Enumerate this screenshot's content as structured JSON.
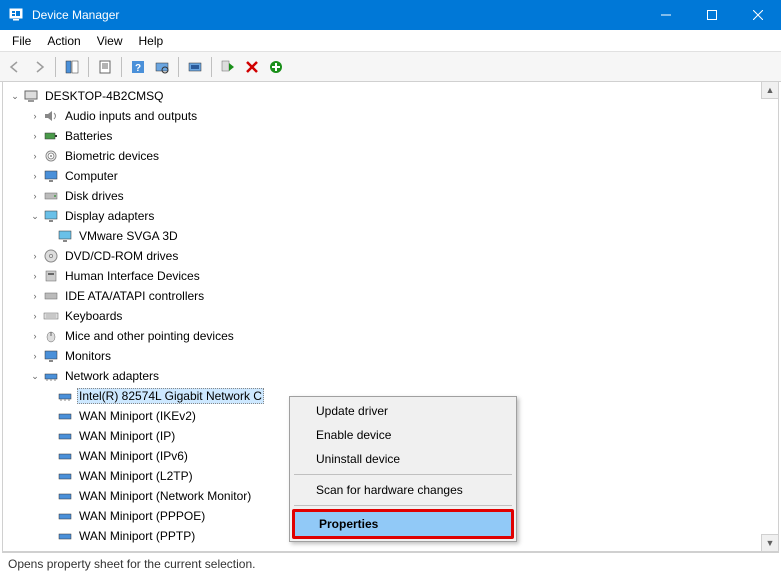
{
  "titlebar": {
    "title": "Device Manager"
  },
  "menubar": {
    "file": "File",
    "action": "Action",
    "view": "View",
    "help": "Help"
  },
  "toolbar": {
    "back": "Back",
    "forward": "Forward",
    "showhide": "Show/Hide Console Tree",
    "properties": "Properties",
    "help": "Help",
    "scan": "Scan for hardware changes",
    "update": "Update device driver",
    "enable": "Enable device",
    "uninstall": "Uninstall device",
    "add": "Add legacy hardware"
  },
  "tree": {
    "root": "DESKTOP-4B2CMSQ",
    "audio": "Audio inputs and outputs",
    "batteries": "Batteries",
    "biometric": "Biometric devices",
    "computer": "Computer",
    "disk": "Disk drives",
    "display": "Display adapters",
    "vmware": "VMware SVGA 3D",
    "dvd": "DVD/CD-ROM drives",
    "hid": "Human Interface Devices",
    "ide": "IDE ATA/ATAPI controllers",
    "keyboards": "Keyboards",
    "mice": "Mice and other pointing devices",
    "monitors": "Monitors",
    "network": "Network adapters",
    "intel": "Intel(R) 82574L Gigabit Network C",
    "wan_ikev2": "WAN Miniport (IKEv2)",
    "wan_ip": "WAN Miniport (IP)",
    "wan_ipv6": "WAN Miniport (IPv6)",
    "wan_l2tp": "WAN Miniport (L2TP)",
    "wan_nm": "WAN Miniport (Network Monitor)",
    "wan_pppoe": "WAN Miniport (PPPOE)",
    "wan_pptp": "WAN Miniport (PPTP)"
  },
  "context_menu": {
    "update": "Update driver",
    "enable": "Enable device",
    "uninstall": "Uninstall device",
    "scan": "Scan for hardware changes",
    "properties": "Properties"
  },
  "status": {
    "text": "Opens property sheet for the current selection."
  },
  "colors": {
    "accent": "#0078d7",
    "highlight_row": "#cde8ff",
    "ctx_highlight": "#91c9f7",
    "ring": "#e00000"
  }
}
